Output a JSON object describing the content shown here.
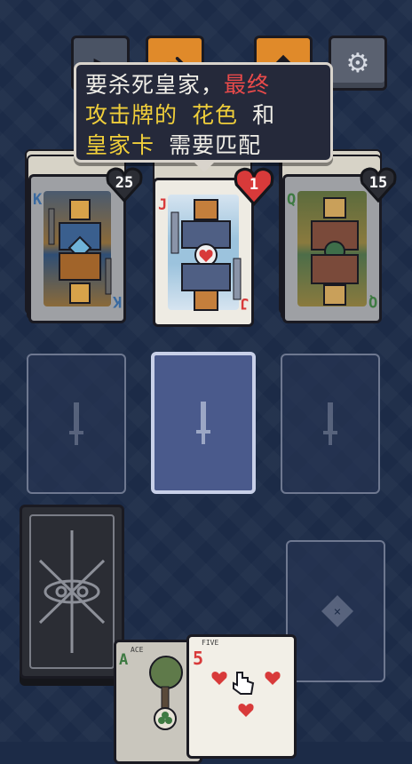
{
  "toolbar": {
    "buttons": [
      {
        "name": "back-button",
        "icon": "back-icon"
      },
      {
        "name": "forward-button",
        "icon": "arrow-icon"
      },
      {
        "name": "map-button",
        "icon": "map-icon"
      },
      {
        "name": "settings-button",
        "icon": "gear-icon"
      }
    ]
  },
  "tooltip": {
    "line1_a": "要杀死皇家，",
    "line1_b": "最终",
    "line2_a": "攻击牌的 花色",
    "line2_b": " 和",
    "line3_a": "皇家卡",
    "line3_b": " 需要匹配"
  },
  "royals": [
    {
      "rank": "K",
      "suit": "spade",
      "hp": "25",
      "state": "dimmed"
    },
    {
      "rank": "J",
      "suit": "heart",
      "hp": "1",
      "state": "active"
    },
    {
      "rank": "Q",
      "suit": "club",
      "hp": "15",
      "state": "dimmed"
    }
  ],
  "hand": [
    {
      "rank": "A",
      "suit": "club",
      "label": "ACE"
    },
    {
      "rank": "5",
      "suit": "heart",
      "label": "FIVE"
    }
  ],
  "colors": {
    "background": "#1c2b47",
    "heart": "#d83a3a",
    "accent_orange": "#e08a2a",
    "slot_active": "#4a5a8c"
  }
}
